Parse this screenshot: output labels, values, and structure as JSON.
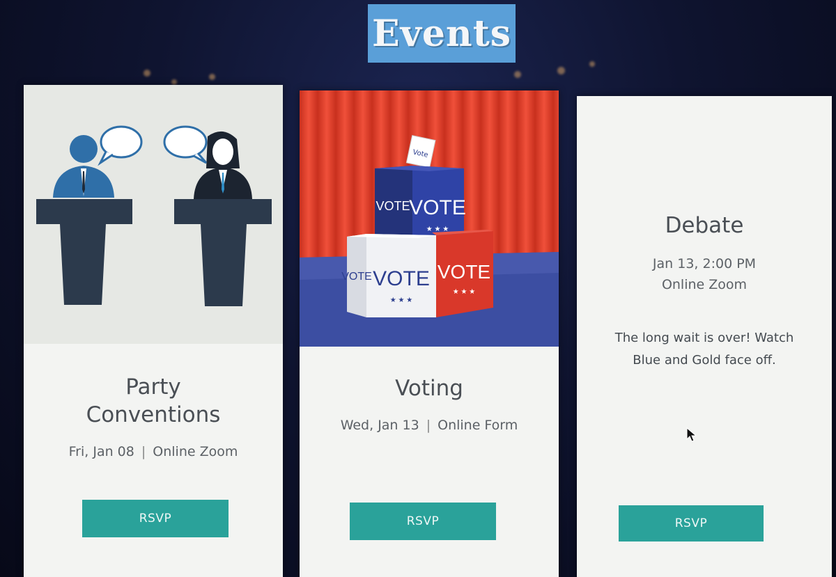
{
  "page": {
    "title": "Events"
  },
  "colors": {
    "accent": "#2aa29a",
    "title_banner": "#5a9fd8",
    "card_bg": "#f3f4f2"
  },
  "events": [
    {
      "title_line1": "Party",
      "title_line2": "Conventions",
      "date": "Fri, Jan 08",
      "separator": "|",
      "location": "Online Zoom",
      "rsvp_label": "RSVP",
      "image_icon": "debate-podiums-illustration"
    },
    {
      "title": "Voting",
      "date": "Wed, Jan 13",
      "separator": "|",
      "location": "Online Form",
      "rsvp_label": "RSVP",
      "image_icon": "ballot-boxes-photo",
      "ballot_box_labels": [
        "VOTE",
        "VOTE",
        "VOTE",
        "VOTE",
        "VOTE"
      ],
      "ballot_text": "Vote"
    },
    {
      "title": "Debate",
      "datetime": "Jan 13, 2:00 PM",
      "location": "Online Zoom",
      "description": "The long wait is over! Watch Blue and Gold face off.",
      "rsvp_label": "RSVP"
    }
  ]
}
